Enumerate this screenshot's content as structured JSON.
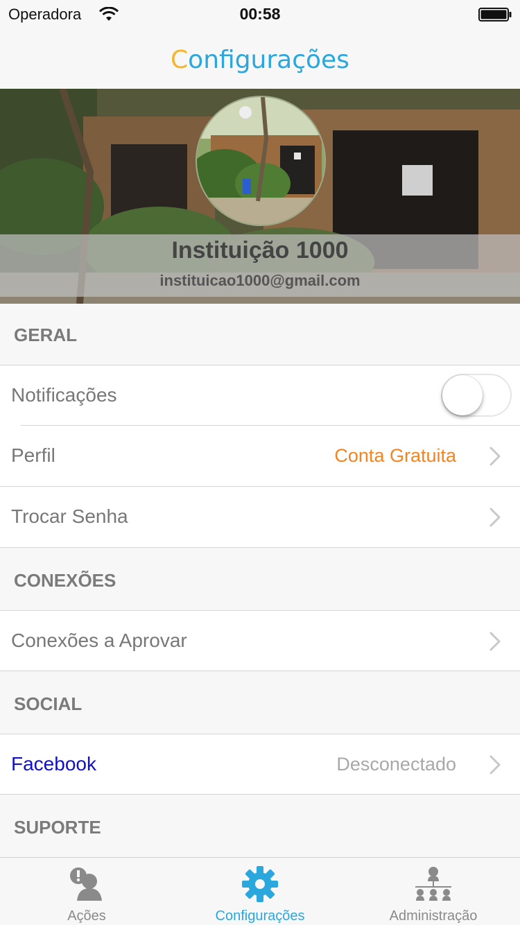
{
  "status_bar": {
    "carrier": "Operadora",
    "time": "00:58"
  },
  "nav": {
    "title_first": "C",
    "title_rest": "onfigurações"
  },
  "profile": {
    "name": "Instituição 1000",
    "email": "instituicao1000@gmail.com"
  },
  "sections": {
    "geral": "GERAL",
    "conexoes": "CONEXÕES",
    "social": "SOCIAL",
    "suporte": "SUPORTE"
  },
  "rows": {
    "notificacoes": {
      "label": "Notificações",
      "toggle_on": false
    },
    "perfil": {
      "label": "Perfil",
      "value": "Conta Gratuita"
    },
    "trocar_senha": {
      "label": "Trocar Senha"
    },
    "conexoes_aprovar": {
      "label": "Conexões a Aprovar"
    },
    "facebook": {
      "label": "Facebook",
      "value": "Desconectado"
    }
  },
  "tabs": [
    {
      "label": "Ações",
      "icon": "alert-user-icon",
      "active": false
    },
    {
      "label": "Configurações",
      "icon": "gear-icon",
      "active": true
    },
    {
      "label": "Administração",
      "icon": "org-chart-icon",
      "active": false
    }
  ],
  "colors": {
    "accent": "#2aa7dd",
    "title_first_letter": "#f7b52b",
    "plan_value": "#f5841f",
    "facebook_label": "#1010c8",
    "secondary_value": "#a8a8a8"
  }
}
